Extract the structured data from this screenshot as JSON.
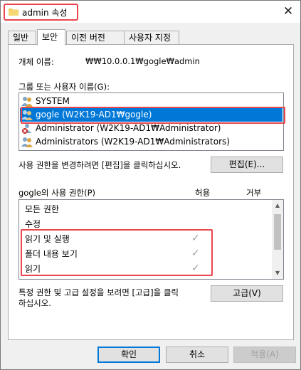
{
  "window": {
    "title": "admin 속성",
    "close_glyph": "✕"
  },
  "tabs": [
    "일반",
    "보안",
    "이전 버전",
    "사용자 지정"
  ],
  "object_name": {
    "label": "개체 이름:",
    "value": "₩₩10.0.0.1₩gogle₩admin"
  },
  "group_section": {
    "label": "그룹 또는 사용자 이름(G):",
    "items": [
      {
        "name": "SYSTEM",
        "icon": "users-group-icon"
      },
      {
        "name": "gogle (W2K19-AD1₩gogle)",
        "icon": "users-group-icon",
        "selected": true
      },
      {
        "name": "Administrator (W2K19-AD1₩Administrator)",
        "icon": "user-denied-icon"
      },
      {
        "name": "Administrators (W2K19-AD1₩Administrators)",
        "icon": "users-group-icon"
      }
    ]
  },
  "edit_hint": "사용 권한을 변경하려면 [편집]을 클릭하십시오.",
  "edit_button": "편집(E)...",
  "permissions": {
    "header": "gogle의 사용 권한(P)",
    "allow_header": "허용",
    "deny_header": "거부",
    "rows": [
      {
        "name": "모든 권한",
        "allow": false,
        "deny": false
      },
      {
        "name": "수정",
        "allow": false,
        "deny": false
      },
      {
        "name": "읽기 및 실행",
        "allow": true,
        "deny": false
      },
      {
        "name": "폴더 내용 보기",
        "allow": true,
        "deny": false
      },
      {
        "name": "읽기",
        "allow": true,
        "deny": false
      }
    ],
    "check_glyph": "✓"
  },
  "advanced_hint_line1": "특정 권한 및 고급 설정을 보려면 [고급]을 클릭",
  "advanced_hint_line2": "하십시오.",
  "advanced_button": "고급(V)",
  "footer": {
    "ok": "확인",
    "cancel": "취소",
    "apply": "적용(A)"
  },
  "colors": {
    "selection": "#0078d7",
    "highlight_outline": "#e8454c"
  }
}
